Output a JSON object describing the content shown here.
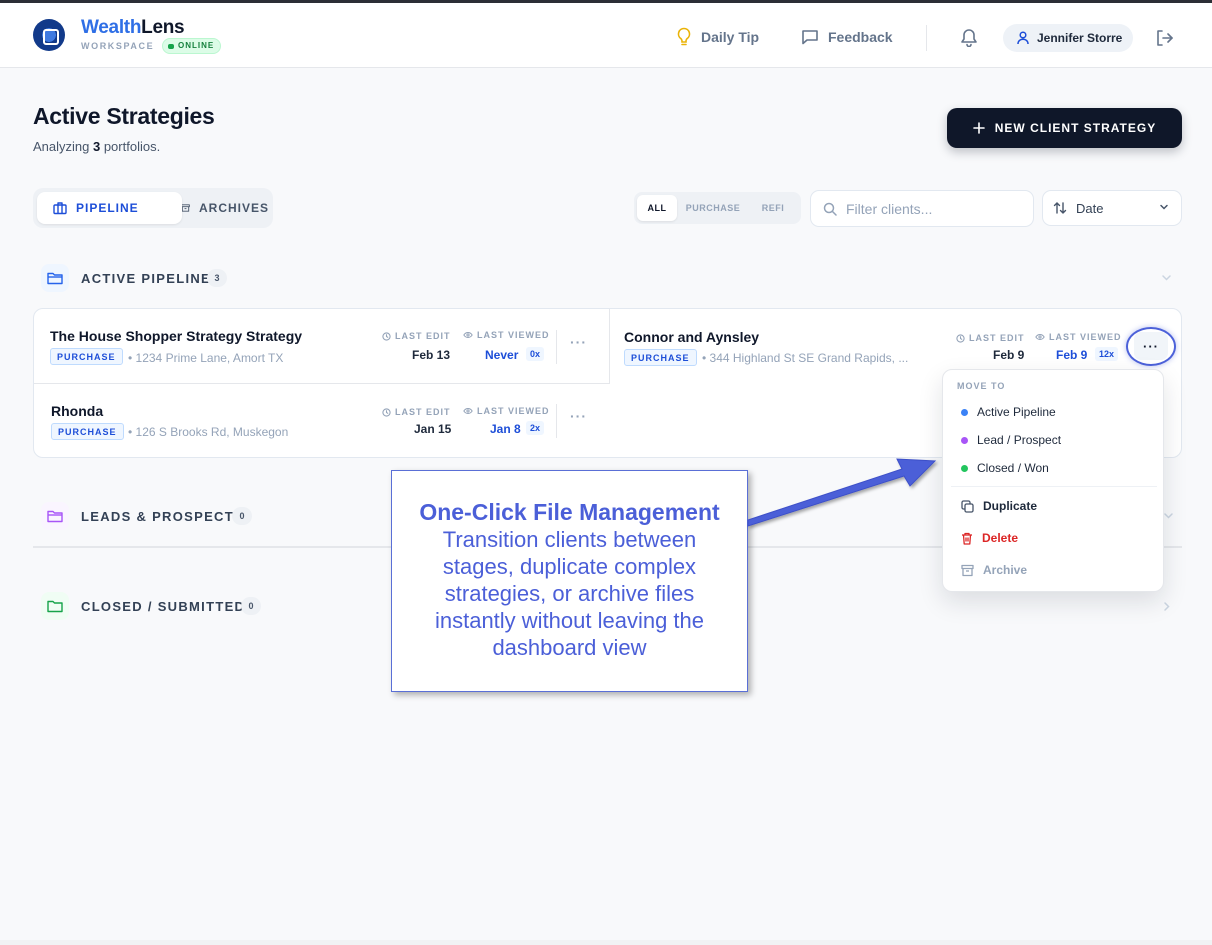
{
  "header": {
    "brand_part1": "Wealth",
    "brand_part2": "Lens",
    "workspace": "WORKSPACE",
    "status": "ONLINE",
    "daily_tip": "Daily Tip",
    "feedback": "Feedback",
    "user": "Jennifer Storre"
  },
  "page": {
    "title": "Active Strategies",
    "subtitle_prefix": "Analyzing ",
    "portfolio_count": "3",
    "subtitle_suffix": " portfolios.",
    "new_button": "NEW CLIENT STRATEGY"
  },
  "view_toggle": {
    "pipeline": "PIPELINE",
    "archives": "ARCHIVES"
  },
  "filters": {
    "segments": [
      "ALL",
      "PURCHASE",
      "REFI"
    ],
    "search_placeholder": "Filter clients...",
    "sort_label": "Date"
  },
  "sections": [
    {
      "title": "ACTIVE PIPELINE",
      "count": "3"
    },
    {
      "title": "LEADS & PROSPECTS",
      "count": "0"
    },
    {
      "title": "CLOSED / SUBMITTED",
      "count": "0"
    }
  ],
  "meta_labels": {
    "last_edit": "LAST EDIT",
    "last_viewed": "LAST VIEWED"
  },
  "cards": [
    {
      "name": "The House Shopper Strategy Strategy",
      "tag": "PURCHASE",
      "address": "• 1234 Prime Lane, Amort TX",
      "last_edit": "Feb 13",
      "last_viewed": "Never",
      "views": "0x"
    },
    {
      "name": "Connor and Aynsley",
      "tag": "PURCHASE",
      "address": "• 344 Highland St SE Grand Rapids, ...",
      "last_edit": "Feb 9",
      "last_viewed": "Feb 9",
      "views": "12x"
    },
    {
      "name": "Rhonda",
      "tag": "PURCHASE",
      "address": "• 126 S Brooks Rd, Muskegon",
      "last_edit": "Jan 15",
      "last_viewed": "Jan 8",
      "views": "2x"
    }
  ],
  "menu": {
    "heading": "MOVE TO",
    "stages": [
      {
        "label": "Active Pipeline",
        "color": "#3b82f6"
      },
      {
        "label": "Lead / Prospect",
        "color": "#a855f7"
      },
      {
        "label": "Closed / Won",
        "color": "#22c55e"
      }
    ],
    "duplicate": "Duplicate",
    "delete": "Delete",
    "archive": "Archive"
  },
  "callout": {
    "title": "One-Click File Management",
    "body": "Transition clients between stages, duplicate complex strategies, or archive files instantly without leaving the dashboard view"
  },
  "colors": {
    "accent": "#1d4ed8",
    "brand_dark": "#0f1729",
    "callout": "#4b5fd8",
    "danger": "#dc2626"
  }
}
